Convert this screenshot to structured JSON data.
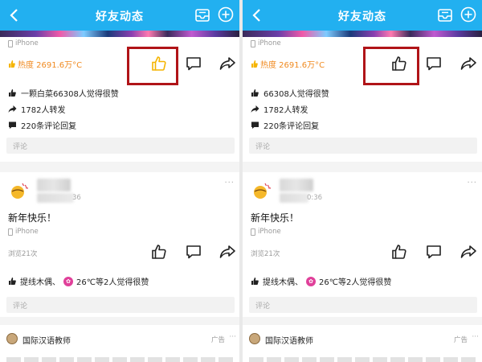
{
  "panels": [
    {
      "header": {
        "title": "好友动态"
      },
      "post1": {
        "device": "iPhone",
        "heat": "热度 2691.6万°C",
        "like_active": true,
        "stats": {
          "likes": "一颗白菜66308人觉得很赞",
          "shares": "1782人转发",
          "comments": "220条评论回复"
        },
        "comment_placeholder": "评论"
      },
      "post2": {
        "time": "36",
        "text": "新年快乐！",
        "device": "iPhone",
        "views": "浏览21次",
        "likers": {
          "first": "提线木偶、",
          "second": "26℃等2人觉得很赞"
        },
        "comment_placeholder": "评论"
      },
      "ad": {
        "name": "国际汉语教师",
        "tag": "广告"
      }
    },
    {
      "header": {
        "title": "好友动态"
      },
      "post1": {
        "device": "iPhone",
        "heat": "热度 2691.6万°C",
        "like_active": false,
        "stats": {
          "likes": "66308人觉得很赞",
          "shares": "1782人转发",
          "comments": "220条评论回复"
        },
        "comment_placeholder": "评论"
      },
      "post2": {
        "time": "0:36",
        "text": "新年快乐！",
        "device": "iPhone",
        "views": "浏览21次",
        "likers": {
          "first": "提线木偶、",
          "second": "26℃等2人觉得很赞"
        },
        "comment_placeholder": "评论"
      },
      "ad": {
        "name": "国际汉语教师",
        "tag": "广告"
      }
    }
  ],
  "colors": {
    "header": "#22b0f0",
    "highlight_box": "#b01418",
    "like_active": "#f5b400",
    "heat": "#f08a20"
  }
}
